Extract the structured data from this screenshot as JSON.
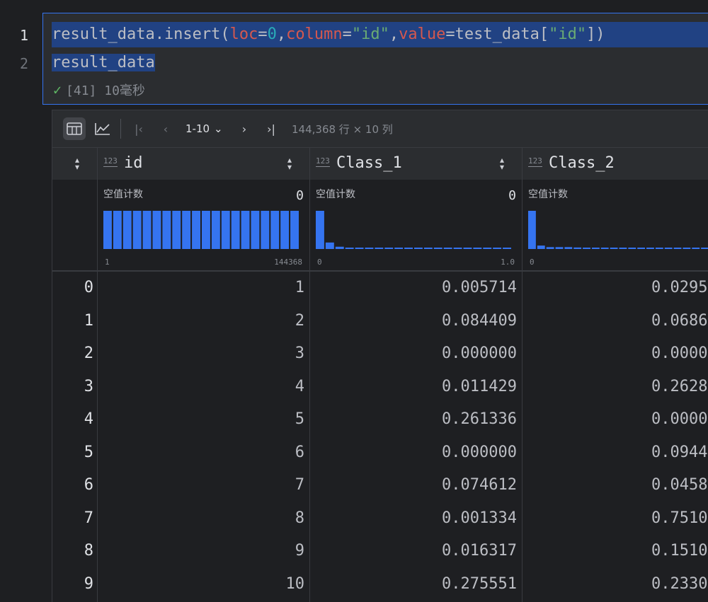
{
  "editor": {
    "line_numbers": [
      "1",
      "2"
    ],
    "line1": {
      "t1": "result_data.insert(",
      "t2": "loc",
      "t3": "=",
      "t4": "0",
      "t5": ",",
      "t6": "column",
      "t7": "=",
      "t8": "\"id\"",
      "t9": ",",
      "t10": "value",
      "t11": "=test_data[",
      "t12": "\"id\"",
      "t13": "])"
    },
    "line2": "result_data",
    "execution": "[41] 10毫秒"
  },
  "toolbar": {
    "table_view_icon": "table-icon",
    "chart_view_icon": "chart-icon",
    "page_range": "1-10",
    "rows_info": "144,368 行 × 10 列"
  },
  "columns": [
    {
      "name": "id",
      "type": "123",
      "null_label": "空值计数",
      "null_count": "0",
      "min_label": "1",
      "max_label": "144368"
    },
    {
      "name": "Class_1",
      "type": "123",
      "null_label": "空值计数",
      "null_count": "0",
      "min_label": "0",
      "max_label": "1.0"
    },
    {
      "name": "Class_2",
      "type": "123",
      "null_label": "空值计数",
      "null_count": "",
      "min_label": "0",
      "max_label": ""
    }
  ],
  "histograms": {
    "id": [
      1,
      1,
      1,
      1,
      1,
      1,
      1,
      1,
      1,
      1,
      1,
      1,
      1,
      1,
      1,
      1,
      1,
      1,
      1,
      1
    ],
    "class_1": [
      1.0,
      0.17,
      0.06,
      0.03,
      0.03,
      0.03,
      0.03,
      0.03,
      0.03,
      0.03,
      0.03,
      0.03,
      0.03,
      0.03,
      0.03,
      0.03,
      0.03,
      0.03,
      0.03,
      0.03
    ],
    "class_2": [
      1.0,
      0.09,
      0.05,
      0.05,
      0.05,
      0.04,
      0.03,
      0.03,
      0.03,
      0.03,
      0.03,
      0.03,
      0.03,
      0.03,
      0.03,
      0.03,
      0.03,
      0.03,
      0.03,
      0.03
    ]
  },
  "rows": [
    {
      "index": "0",
      "id": "1",
      "class_1": "0.005714",
      "class_2": "0.0295"
    },
    {
      "index": "1",
      "id": "2",
      "class_1": "0.084409",
      "class_2": "0.0686"
    },
    {
      "index": "2",
      "id": "3",
      "class_1": "0.000000",
      "class_2": "0.0000"
    },
    {
      "index": "3",
      "id": "4",
      "class_1": "0.011429",
      "class_2": "0.2628"
    },
    {
      "index": "4",
      "id": "5",
      "class_1": "0.261336",
      "class_2": "0.0000"
    },
    {
      "index": "5",
      "id": "6",
      "class_1": "0.000000",
      "class_2": "0.0944"
    },
    {
      "index": "6",
      "id": "7",
      "class_1": "0.074612",
      "class_2": "0.0458"
    },
    {
      "index": "7",
      "id": "8",
      "class_1": "0.001334",
      "class_2": "0.7510"
    },
    {
      "index": "8",
      "id": "9",
      "class_1": "0.016317",
      "class_2": "0.1510"
    },
    {
      "index": "9",
      "id": "10",
      "class_1": "0.275551",
      "class_2": "0.2330"
    }
  ],
  "colors": {
    "accent": "#3574f0",
    "bar": "#3574f0",
    "selection": "#214283"
  }
}
